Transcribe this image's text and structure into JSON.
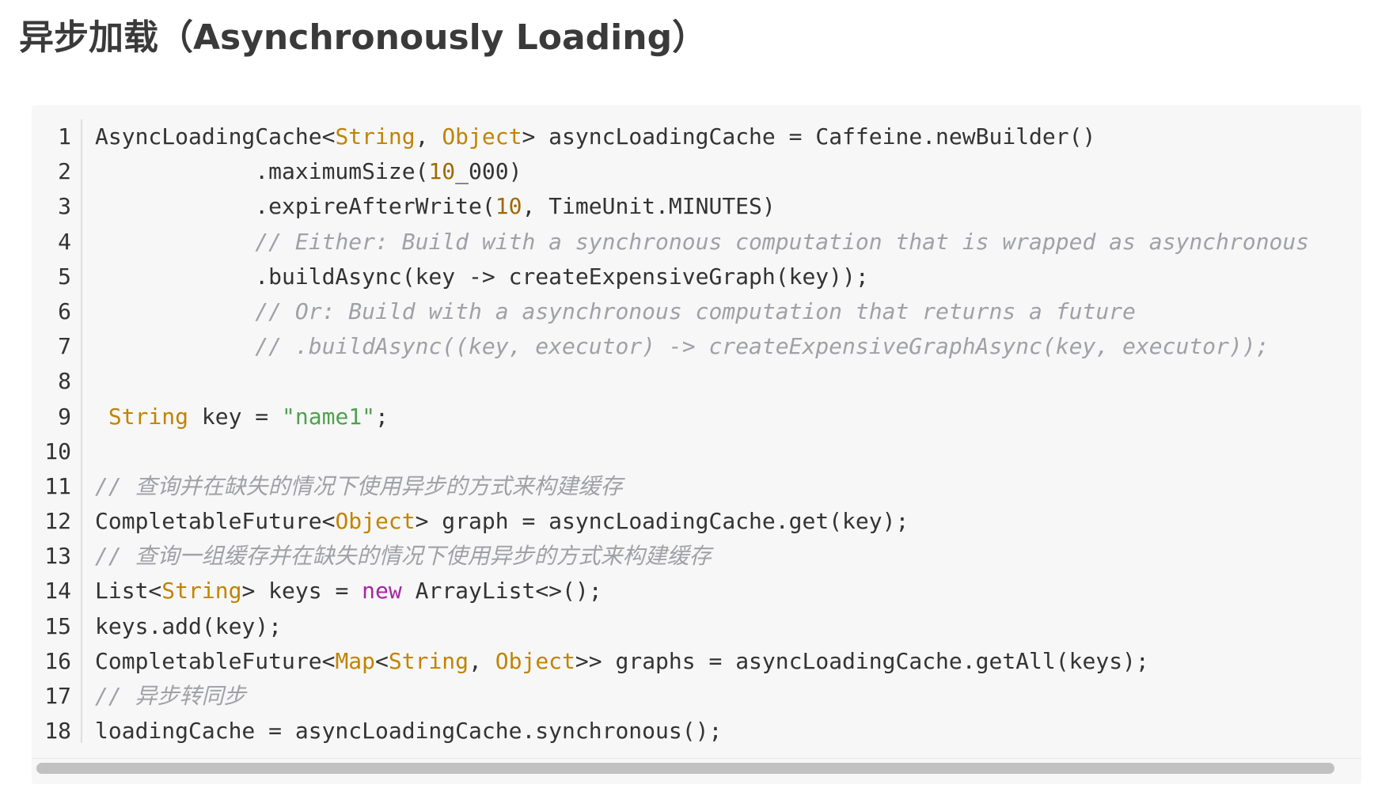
{
  "page": {
    "title": "异步加载（Asynchronously Loading）"
  },
  "colors": {
    "background": "#f7f7f7",
    "text": "#333333",
    "type": "#c18401",
    "number": "#a06a00",
    "string": "#50a14f",
    "keyword": "#a626a4",
    "comment": "#a0a1a7",
    "scrollbar_thumb": "#c1c1c1"
  },
  "code_block": {
    "language": "java",
    "lines": [
      {
        "number": "1",
        "tokens": [
          {
            "type": "plain",
            "text": "AsyncLoadingCache<"
          },
          {
            "type": "type",
            "text": "String"
          },
          {
            "type": "plain",
            "text": ", "
          },
          {
            "type": "type",
            "text": "Object"
          },
          {
            "type": "plain",
            "text": "> asyncLoadingCache = Caffeine.newBuilder()"
          }
        ]
      },
      {
        "number": "2",
        "tokens": [
          {
            "type": "plain",
            "text": "            .maximumSize("
          },
          {
            "type": "number",
            "text": "10"
          },
          {
            "type": "plain",
            "text": "_000)"
          }
        ]
      },
      {
        "number": "3",
        "tokens": [
          {
            "type": "plain",
            "text": "            .expireAfterWrite("
          },
          {
            "type": "number",
            "text": "10"
          },
          {
            "type": "plain",
            "text": ", TimeUnit.MINUTES)"
          }
        ]
      },
      {
        "number": "4",
        "tokens": [
          {
            "type": "plain",
            "text": "            "
          },
          {
            "type": "comment",
            "text": "// Either: Build with a synchronous computation that is wrapped as asynchronous"
          }
        ]
      },
      {
        "number": "5",
        "tokens": [
          {
            "type": "plain",
            "text": "            .buildAsync(key -> createExpensiveGraph(key));"
          }
        ]
      },
      {
        "number": "6",
        "tokens": [
          {
            "type": "plain",
            "text": "            "
          },
          {
            "type": "comment",
            "text": "// Or: Build with a asynchronous computation that returns a future"
          }
        ]
      },
      {
        "number": "7",
        "tokens": [
          {
            "type": "plain",
            "text": "            "
          },
          {
            "type": "comment",
            "text": "// .buildAsync((key, executor) -> createExpensiveGraphAsync(key, executor));"
          }
        ]
      },
      {
        "number": "8",
        "tokens": []
      },
      {
        "number": "9",
        "tokens": [
          {
            "type": "plain",
            "text": " "
          },
          {
            "type": "type",
            "text": "String"
          },
          {
            "type": "plain",
            "text": " key = "
          },
          {
            "type": "string",
            "text": "\"name1\""
          },
          {
            "type": "plain",
            "text": ";"
          }
        ]
      },
      {
        "number": "10",
        "tokens": []
      },
      {
        "number": "11",
        "tokens": [
          {
            "type": "comment",
            "text": "// 查询并在缺失的情况下使用异步的方式来构建缓存"
          }
        ]
      },
      {
        "number": "12",
        "tokens": [
          {
            "type": "plain",
            "text": "CompletableFuture<"
          },
          {
            "type": "type",
            "text": "Object"
          },
          {
            "type": "plain",
            "text": "> graph = asyncLoadingCache.get(key);"
          }
        ]
      },
      {
        "number": "13",
        "tokens": [
          {
            "type": "comment",
            "text": "// 查询一组缓存并在缺失的情况下使用异步的方式来构建缓存"
          }
        ]
      },
      {
        "number": "14",
        "tokens": [
          {
            "type": "plain",
            "text": "List<"
          },
          {
            "type": "type",
            "text": "String"
          },
          {
            "type": "plain",
            "text": "> keys = "
          },
          {
            "type": "keyword",
            "text": "new"
          },
          {
            "type": "plain",
            "text": " ArrayList<>();"
          }
        ]
      },
      {
        "number": "15",
        "tokens": [
          {
            "type": "plain",
            "text": "keys.add(key);"
          }
        ]
      },
      {
        "number": "16",
        "tokens": [
          {
            "type": "plain",
            "text": "CompletableFuture<"
          },
          {
            "type": "type",
            "text": "Map"
          },
          {
            "type": "plain",
            "text": "<"
          },
          {
            "type": "type",
            "text": "String"
          },
          {
            "type": "plain",
            "text": ", "
          },
          {
            "type": "type",
            "text": "Object"
          },
          {
            "type": "plain",
            "text": ">> graphs = asyncLoadingCache.getAll(keys);"
          }
        ]
      },
      {
        "number": "17",
        "tokens": [
          {
            "type": "comment",
            "text": "// 异步转同步"
          }
        ]
      },
      {
        "number": "18",
        "tokens": [
          {
            "type": "plain",
            "text": "loadingCache = asyncLoadingCache.synchronous();"
          }
        ]
      }
    ]
  }
}
